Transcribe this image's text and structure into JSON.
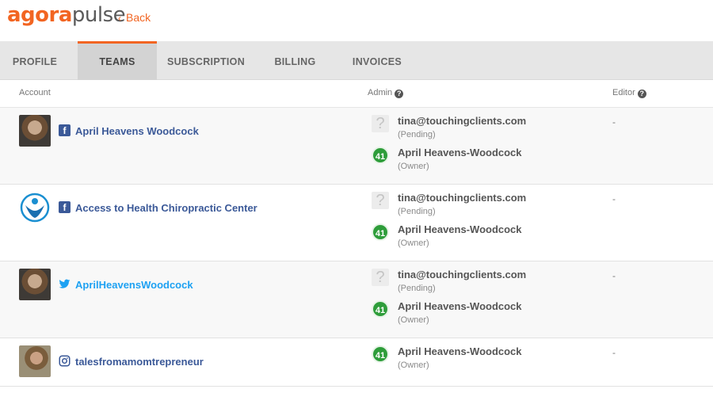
{
  "brand": {
    "part1": "agora",
    "part2": "pulse",
    "color": "#f26522"
  },
  "nav": {
    "back_label": "Back",
    "back_icon": "chevron-left-icon"
  },
  "tabs": [
    {
      "label": "PROFILE"
    },
    {
      "label": "TEAMS",
      "active": true
    },
    {
      "label": "SUBSCRIPTION"
    },
    {
      "label": "BILLING"
    },
    {
      "label": "INVOICES"
    }
  ],
  "columns": {
    "account": "Account",
    "admin": "Admin",
    "editor": "Editor",
    "help_icon": "question-circle-icon"
  },
  "rows": [
    {
      "network": "facebook",
      "account": "April Heavens Woodcock",
      "admins": [
        {
          "name": "tina@touchingclients.com",
          "role": "(Pending)",
          "icon": "unknown-user-icon"
        },
        {
          "name": "April Heavens-Woodcock",
          "role": "(Owner)",
          "icon": "owner-avatar-icon",
          "badge": "41"
        }
      ],
      "editor": "-"
    },
    {
      "network": "facebook",
      "account": "Access to Health Chiropractic Center",
      "admins": [
        {
          "name": "tina@touchingclients.com",
          "role": "(Pending)",
          "icon": "unknown-user-icon"
        },
        {
          "name": "April Heavens-Woodcock",
          "role": "(Owner)",
          "icon": "owner-avatar-icon",
          "badge": "41"
        }
      ],
      "editor": "-"
    },
    {
      "network": "twitter",
      "account": "AprilHeavensWoodcock",
      "admins": [
        {
          "name": "tina@touchingclients.com",
          "role": "(Pending)",
          "icon": "unknown-user-icon"
        },
        {
          "name": "April Heavens-Woodcock",
          "role": "(Owner)",
          "icon": "owner-avatar-icon",
          "badge": "41"
        }
      ],
      "editor": "-"
    },
    {
      "network": "instagram",
      "account": "talesfromamomtrepreneur",
      "admins": [
        {
          "name": "April Heavens-Woodcock",
          "role": "(Owner)",
          "icon": "owner-avatar-icon",
          "badge": "41"
        }
      ],
      "editor": "-"
    }
  ],
  "colors": {
    "facebook": "#3b5998",
    "twitter": "#1da1f2",
    "accent": "#f26522",
    "owner_badge": "#2e9d3a"
  }
}
